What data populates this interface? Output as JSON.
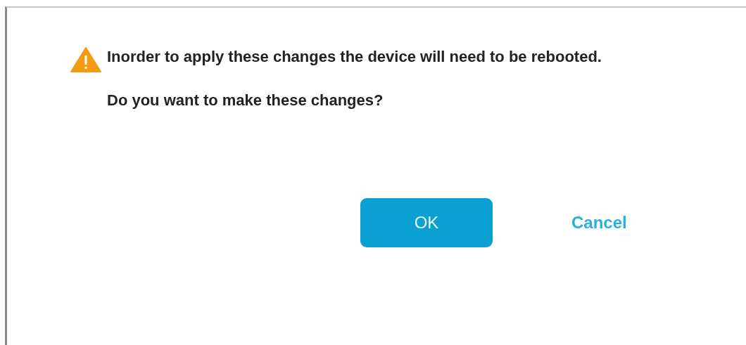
{
  "dialog": {
    "message": "Inorder to apply these changes the device will need to be rebooted.",
    "question": "Do you want to make these changes?",
    "buttons": [
      {
        "label": "OK",
        "kind": "primary"
      },
      {
        "label": "Cancel",
        "kind": "link"
      }
    ]
  }
}
